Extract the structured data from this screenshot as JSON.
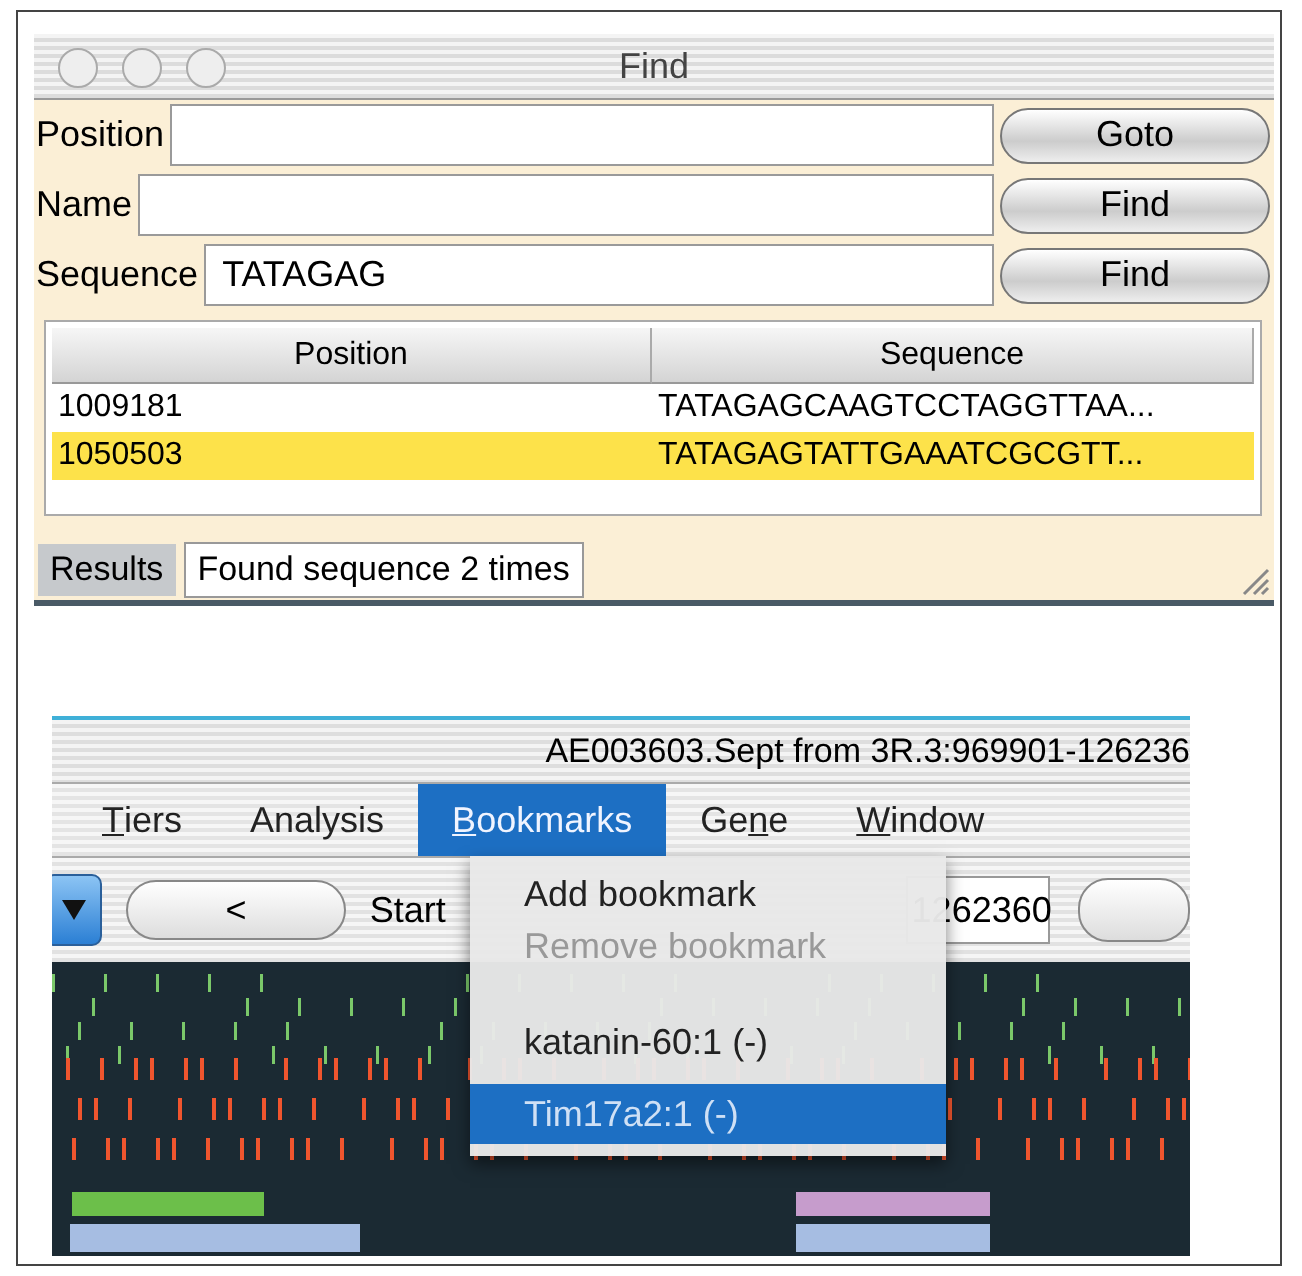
{
  "find_window": {
    "title": "Find",
    "fields": [
      {
        "label": "Position",
        "button": "Goto"
      },
      {
        "label": "Name",
        "button": "Find"
      },
      {
        "label": "Sequence",
        "value": "TATAGAG",
        "button": "Find"
      }
    ],
    "table": {
      "columns": [
        "Position",
        "Sequence"
      ],
      "rows": [
        {
          "cells": [
            "1009181",
            "TATAGAGCAAGTCCTAGGTTAA..."
          ],
          "selected": false
        },
        {
          "cells": [
            "1050503",
            "TATAGAGTATTGAAATCGCGTT..."
          ],
          "selected": true
        }
      ]
    },
    "status_bar": {
      "label": "Results",
      "message": "Found sequence 2 times"
    }
  },
  "browser_window": {
    "title": "AE003603.Sept from 3R.3:969901-126236",
    "menu": [
      {
        "key": "T",
        "rest": "iers",
        "selected": false
      },
      {
        "rest": "Analysis",
        "selected": false
      },
      {
        "key": "B",
        "rest": "ookmarks",
        "selected": true
      },
      {
        "lead": "Ge",
        "key": "n",
        "rest": "e",
        "selected": false
      },
      {
        "key": "W",
        "rest": "indow",
        "selected": false
      }
    ],
    "toolbar": {
      "back_button": "<",
      "start_label": "Start",
      "end_value": "1262360"
    },
    "dropdown": [
      {
        "kind": "item",
        "label": "Add bookmark",
        "disabled": false,
        "selected": false
      },
      {
        "kind": "item",
        "label": "Remove bookmark",
        "disabled": true,
        "selected": false
      },
      {
        "kind": "separator"
      },
      {
        "kind": "item",
        "label": "katanin-60:1 (-)",
        "disabled": false,
        "selected": false
      },
      {
        "kind": "item",
        "label": "Tim17a2:1 (-)",
        "disabled": false,
        "selected": true
      }
    ]
  }
}
